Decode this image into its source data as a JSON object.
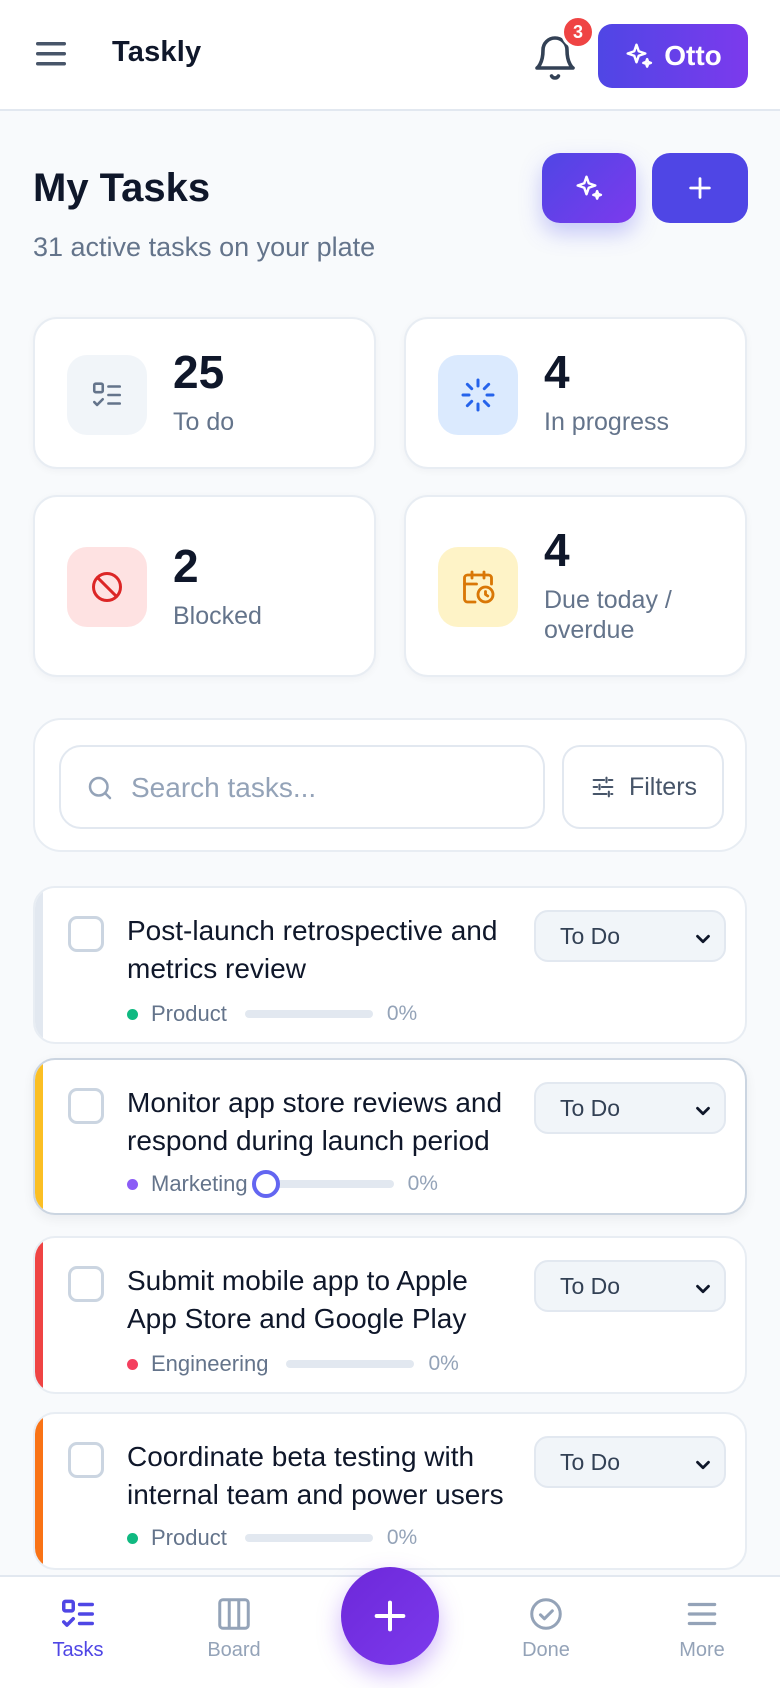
{
  "header": {
    "app_title": "Taskly",
    "notification_count": "3",
    "assistant_label": "Otto"
  },
  "page": {
    "title": "My Tasks",
    "subtitle": "31 active tasks on your plate"
  },
  "stats": [
    {
      "value": "25",
      "label": "To do",
      "icon": "checklist-icon",
      "icon_bg": "#f1f5f9",
      "icon_color": "#64748b"
    },
    {
      "value": "4",
      "label": "In progress",
      "icon": "loader-icon",
      "icon_bg": "#dbeafe",
      "icon_color": "#2563eb"
    },
    {
      "value": "2",
      "label": "Blocked",
      "icon": "ban-icon",
      "icon_bg": "#fee2e2",
      "icon_color": "#dc2626"
    },
    {
      "value": "4",
      "label": "Due today / overdue",
      "icon": "calendar-clock-icon",
      "icon_bg": "#fef3c7",
      "icon_color": "#d97706"
    }
  ],
  "search": {
    "placeholder": "Search tasks...",
    "filters_label": "Filters"
  },
  "tasks": [
    {
      "title": "Post-launch retrospective and metrics review",
      "category": "Product",
      "category_color": "#10b981",
      "accent": "#e2e8f0",
      "progress": 0,
      "progress_label": "0%",
      "status": "To Do"
    },
    {
      "title": "Monitor app store reviews and respond during launch period",
      "category": "Marketing",
      "category_color": "#8b5cf6",
      "accent": "#fbbf24",
      "progress": 0,
      "progress_label": "0%",
      "status": "To Do"
    },
    {
      "title": "Submit mobile app to Apple App Store and Google Play",
      "category": "Engineering",
      "category_color": "#f43f5e",
      "accent": "#ef4444",
      "progress": 0,
      "progress_label": "0%",
      "status": "To Do"
    },
    {
      "title": "Coordinate beta testing with internal team and power users",
      "category": "Product",
      "category_color": "#10b981",
      "accent": "#f97316",
      "progress": 0,
      "progress_label": "0%",
      "status": "To Do"
    }
  ],
  "nav": {
    "tasks": "Tasks",
    "board": "Board",
    "done": "Done",
    "more": "More"
  },
  "colors": {
    "primary": "#4f46e5",
    "accent_purple": "#7c3aed"
  }
}
